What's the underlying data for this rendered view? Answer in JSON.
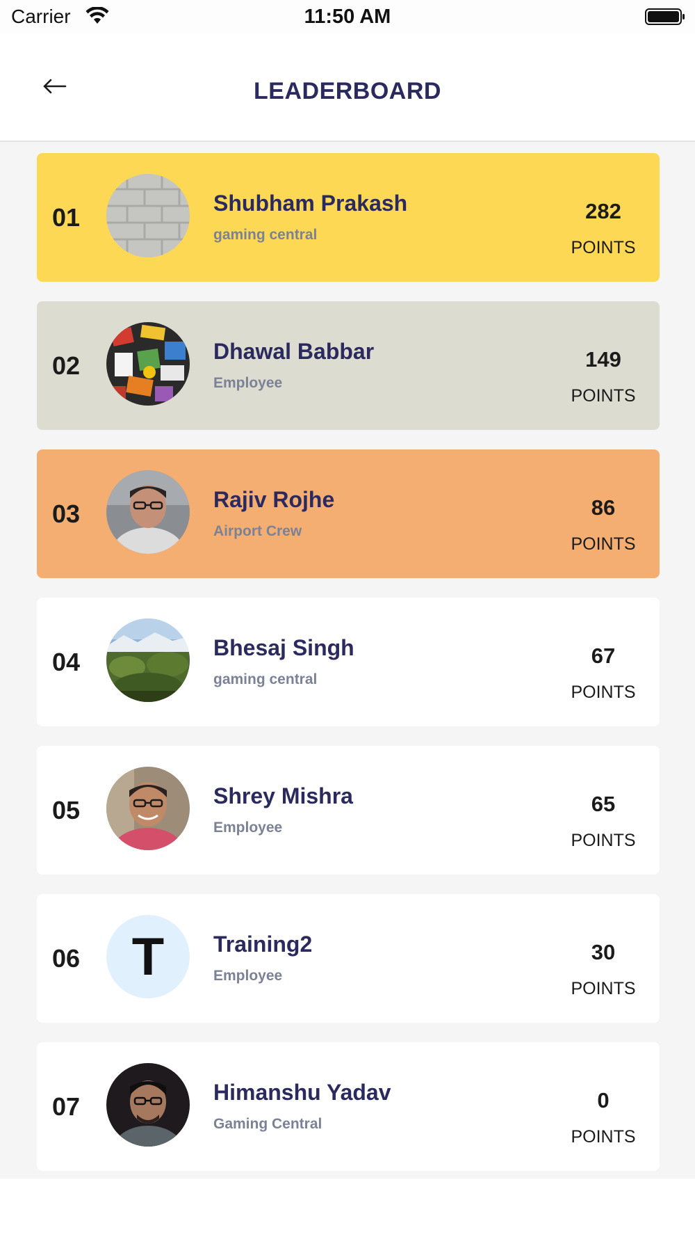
{
  "status_bar": {
    "carrier": "Carrier",
    "time": "11:50 AM",
    "wifi_icon": "wifi-icon",
    "battery_icon": "battery-icon"
  },
  "header": {
    "title": "LEADERBOARD",
    "back_icon": "arrow-left-icon"
  },
  "points_label": "POINTS",
  "leaders": [
    {
      "rank": "01",
      "name": "Shubham Prakash",
      "role": "gaming central",
      "points": "282",
      "card_color": "#fdd854",
      "avatar": "brick-wall-photo"
    },
    {
      "rank": "02",
      "name": "Dhawal Babbar",
      "role": "Employee",
      "points": "149",
      "card_color": "#dddcd1",
      "avatar": "stickers-photo"
    },
    {
      "rank": "03",
      "name": "Rajiv Rojhe",
      "role": "Airport Crew",
      "points": "86",
      "card_color": "#f4ae72",
      "avatar": "man-glasses-photo"
    },
    {
      "rank": "04",
      "name": "Bhesaj Singh",
      "role": "gaming central",
      "points": "67",
      "card_color": "#ffffff",
      "avatar": "landscape-photo"
    },
    {
      "rank": "05",
      "name": "Shrey Mishra",
      "role": "Employee",
      "points": "65",
      "card_color": "#ffffff",
      "avatar": "smiling-man-photo"
    },
    {
      "rank": "06",
      "name": "Training2",
      "role": "Employee",
      "points": "30",
      "card_color": "#ffffff",
      "avatar": "T"
    },
    {
      "rank": "07",
      "name": "Himanshu Yadav",
      "role": "Gaming Central",
      "points": "0",
      "card_color": "#ffffff",
      "avatar": "man-dark-photo"
    }
  ]
}
